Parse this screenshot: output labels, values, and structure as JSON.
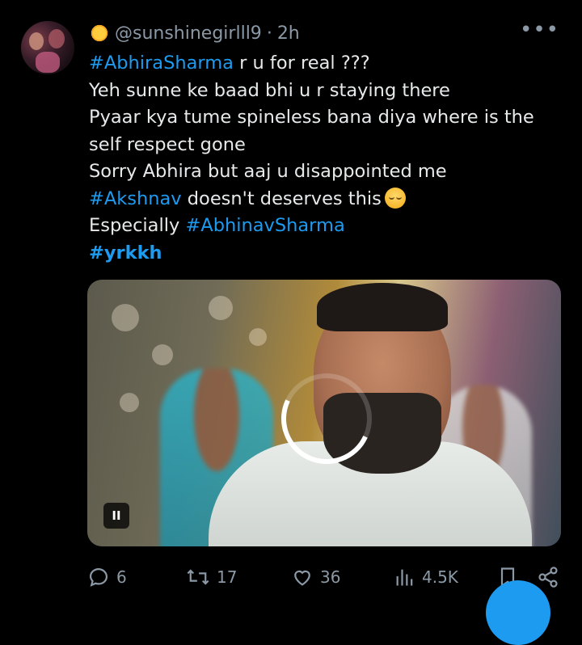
{
  "post": {
    "handle": "@sunshinegirlll9",
    "separator": "·",
    "time": "2h",
    "more": "•••",
    "lines": {
      "l1_tag": "#AbhiraSharma",
      "l1_text": " r u for real ???",
      "l2": "Yeh sunne ke baad bhi u r staying there",
      "l3": "Pyaar kya tume spineless bana diya where is the",
      "l4": "self respect gone",
      "l5": "Sorry Abhira but aaj u disappointed me",
      "l6_tag": "#Akshnav",
      "l6_text": " doesn't deserves this",
      "l7_text": "Especially ",
      "l7_tag": "#AbhinavSharma",
      "l8_tag": "#yrkkh"
    },
    "emoji_name": "pensive-face-emoji",
    "video": {
      "pause_label": "II",
      "state": "loading"
    }
  },
  "actions": {
    "replies": "6",
    "reposts": "17",
    "likes": "36",
    "views": "4.5K"
  },
  "colors": {
    "background": "#000000",
    "text": "#e7e9ea",
    "muted": "#8b98a5",
    "accent": "#1d9bf0"
  },
  "icons": [
    "sun-emoji-icon",
    "more-icon",
    "reply-icon",
    "repost-icon",
    "like-icon",
    "views-icon",
    "bookmark-icon",
    "share-icon"
  ]
}
